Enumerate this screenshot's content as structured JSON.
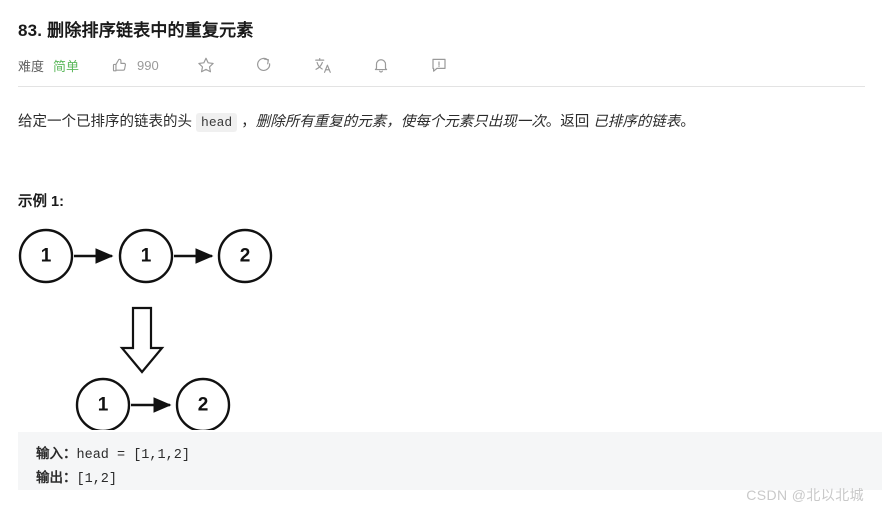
{
  "problem": {
    "title": "83. 删除排序链表中的重复元素",
    "difficulty_label": "难度",
    "difficulty_value": "简单",
    "like_count": "990"
  },
  "toolbar": {
    "icons": [
      {
        "name": "thumbs-up-icon",
        "label": "点赞"
      },
      {
        "name": "star-icon",
        "label": "收藏"
      },
      {
        "name": "share-icon",
        "label": "分享"
      },
      {
        "name": "translate-icon",
        "label": "切换语言"
      },
      {
        "name": "bell-icon",
        "label": "提醒"
      },
      {
        "name": "feedback-icon",
        "label": "反馈"
      }
    ]
  },
  "description": {
    "part1": "给定一个已排序的链表的头 ",
    "code": "head",
    "part2": " ，",
    "emphasis1": "删除所有重复的元素，使每个元素只出现一次",
    "part3": "。返回 ",
    "emphasis2": "已排序的链表",
    "part4": "。"
  },
  "example": {
    "heading": "示例 1:",
    "input_label": "输入：",
    "input_value": "head = [1,1,2]",
    "output_label": "输出：",
    "output_value": "[1,2]"
  },
  "diagram": {
    "before_nodes": [
      "1",
      "1",
      "2"
    ],
    "after_nodes": [
      "1",
      "2"
    ],
    "transform_arrow": "down-arrow"
  },
  "watermark": {
    "text": "CSDN @北以北城"
  },
  "colors": {
    "difficulty_easy": "#5cb85c",
    "icon_gray": "#9a9a9a",
    "divider": "#e3e3e3",
    "code_bg": "#f5f6f7",
    "watermark": "#c9c9c9"
  }
}
